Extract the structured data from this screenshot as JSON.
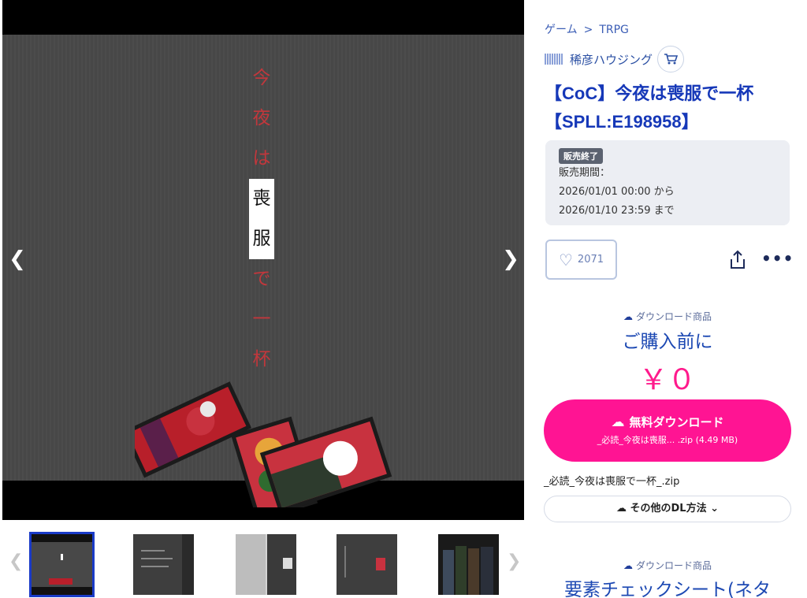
{
  "gallery": {
    "title_chars": [
      "今",
      "夜",
      "は",
      "喪",
      "服",
      "で",
      "一",
      "杯"
    ],
    "boxed_indices": [
      3,
      4
    ],
    "prev_icon": "chevron-left-icon",
    "next_icon": "chevron-right-icon",
    "thumbs": [
      {
        "name": "thumb-1",
        "theme": "black"
      },
      {
        "name": "thumb-2",
        "theme": "gray"
      },
      {
        "name": "thumb-3",
        "theme": "light"
      },
      {
        "name": "thumb-4",
        "theme": "gray"
      },
      {
        "name": "thumb-5",
        "theme": "black"
      }
    ]
  },
  "breadcrumb": {
    "items": [
      "ゲーム",
      "TRPG"
    ],
    "separator": ">"
  },
  "shop": {
    "name": "稀彦ハウジング",
    "cart_icon": "cart-icon"
  },
  "product": {
    "title": "【CoC】今夜は喪服で一杯【SPLL:E198958】"
  },
  "sale": {
    "badge": "販売終了",
    "period_label": "販売期間：",
    "start": "2026/01/01 00:00 から",
    "end": "2026/01/10 23:59 まで"
  },
  "actions": {
    "like_count": "2071",
    "share_icon": "share-icon",
    "more_label": "•••"
  },
  "download": {
    "tag": "ダウンロード商品",
    "before_purchase": "ご購入前に",
    "price": "￥０",
    "free_label": "無料ダウンロード",
    "free_file": "_必読_今夜は喪服... .zip (4.49 MB)",
    "file_name": "_必読_今夜は喪服で一杯_.zip",
    "other_label": "その他のDL方法"
  },
  "next_item": {
    "tag": "ダウンロード商品",
    "title": "要素チェックシート(ネタ"
  },
  "colors": {
    "accent": "#ff1493",
    "link": "#1638b8",
    "title_red": "#c2373c"
  }
}
